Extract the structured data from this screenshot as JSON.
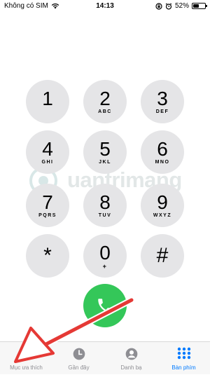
{
  "status_bar": {
    "carrier": "Không có SIM",
    "time": "14:13",
    "battery_percent": "52%",
    "battery_level": 0.52,
    "icons": [
      "wifi-icon",
      "alarm-icon",
      "rotation-lock-icon",
      "battery-icon"
    ]
  },
  "keypad": {
    "keys": [
      {
        "digit": "1",
        "letters": ""
      },
      {
        "digit": "2",
        "letters": "ABC"
      },
      {
        "digit": "3",
        "letters": "DEF"
      },
      {
        "digit": "4",
        "letters": "GHI"
      },
      {
        "digit": "5",
        "letters": "JKL"
      },
      {
        "digit": "6",
        "letters": "MNO"
      },
      {
        "digit": "7",
        "letters": "PQRS"
      },
      {
        "digit": "8",
        "letters": "TUV"
      },
      {
        "digit": "9",
        "letters": "WXYZ"
      },
      {
        "digit": "*",
        "letters": ""
      },
      {
        "digit": "0",
        "letters": "+"
      },
      {
        "digit": "#",
        "letters": ""
      }
    ],
    "call_button_icon": "phone-icon",
    "call_color": "#34c759",
    "key_color": "#e5e5e7"
  },
  "watermark": {
    "text": "uantrimang"
  },
  "tabbar": {
    "active_color": "#007aff",
    "tabs": [
      {
        "label": "Mục ưa thích",
        "icon": "star-icon",
        "active": false
      },
      {
        "label": "Gần đây",
        "icon": "clock-icon",
        "active": false
      },
      {
        "label": "Danh bạ",
        "icon": "contacts-icon",
        "active": false
      },
      {
        "label": "Bàn phím",
        "icon": "keypad-icon",
        "active": true
      }
    ]
  },
  "annotation": {
    "arrow_color": "#e53935"
  }
}
